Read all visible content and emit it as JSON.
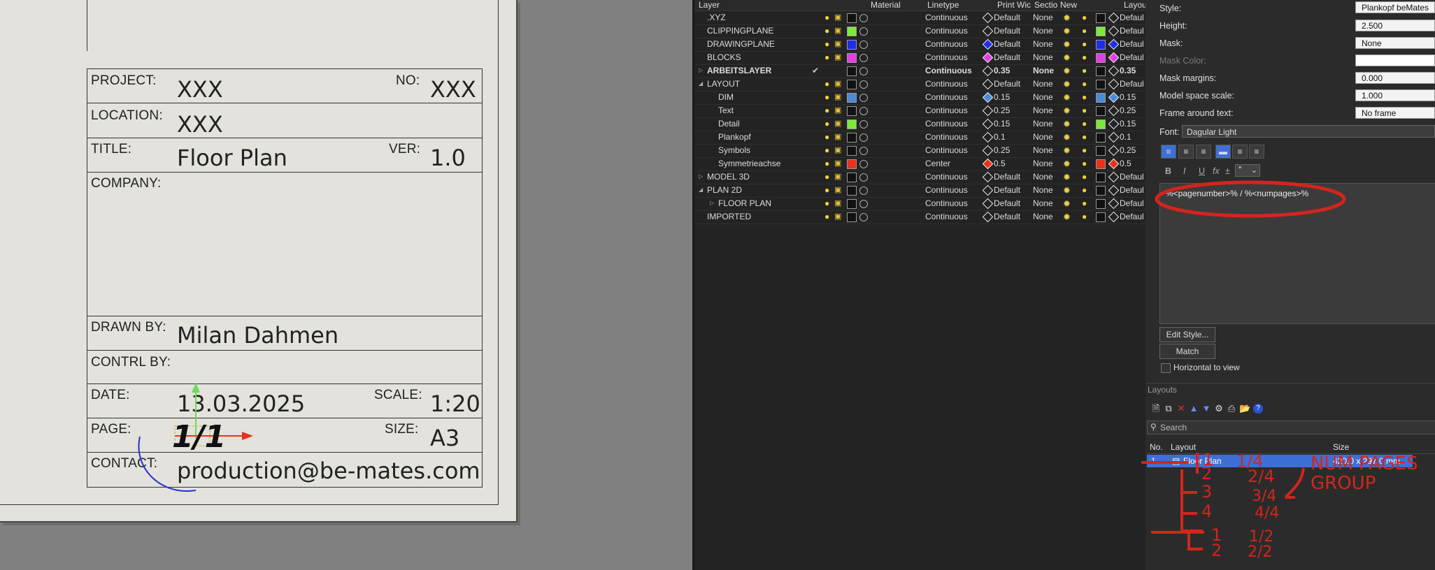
{
  "title_block": {
    "project_label": "PROJECT:",
    "project_value": "XXX",
    "no_label": "NO:",
    "no_value": "XXX",
    "location_label": "LOCATION:",
    "location_value": "XXX",
    "title_label": "TITLE:",
    "title_value": "Floor Plan",
    "ver_label": "VER:",
    "ver_value": "1.0",
    "company_label": "COMPANY:",
    "drawn_by_label": "DRAWN BY:",
    "drawn_by_value": "Milan Dahmen",
    "contrl_by_label": "CONTRL BY:",
    "date_label": "DATE:",
    "date_value": "13.03.2025",
    "scale_label": "SCALE:",
    "scale_value": "1:20",
    "page_label": "PAGE:",
    "page_value": "1/1",
    "size_label": "SIZE:",
    "size_value": "A3",
    "contact_label": "CONTACT:",
    "contact_value": "production@be-mates.com"
  },
  "layer_panel": {
    "headers": [
      "Layer",
      "Material",
      "Linetype",
      "Print Wic",
      "Sectio",
      "New",
      "Layou"
    ],
    "rows": [
      {
        "name": ".XYZ",
        "linetype": "Continuous",
        "print": "Default",
        "section": "None",
        "layout": "Defaul",
        "color": "#111111",
        "bold": false
      },
      {
        "name": "CLIPPINGPLANE",
        "linetype": "Continuous",
        "print": "Default",
        "section": "None",
        "layout": "Defaul",
        "color": "#7ee83a",
        "bold": false
      },
      {
        "name": "DRAWINGPLANE",
        "linetype": "Continuous",
        "print": "Default",
        "section": "None",
        "layout": "Defaul",
        "color": "#1f2ee8",
        "bold": false
      },
      {
        "name": "BLOCKS",
        "linetype": "Continuous",
        "print": "Default",
        "section": "None",
        "layout": "Defaul",
        "color": "#e040e0",
        "bold": false
      },
      {
        "name": "ARBEITSLAYER",
        "linetype": "Continuous",
        "print": "0.35",
        "section": "None",
        "layout": "0.35",
        "color": "#111111",
        "bold": true
      },
      {
        "name": "LAYOUT",
        "linetype": "Continuous",
        "print": "Default",
        "section": "None",
        "layout": "Defaul",
        "color": "#111111",
        "bold": false
      },
      {
        "name": "DIM",
        "linetype": "Continuous",
        "print": "0.15",
        "section": "None",
        "layout": "0.15",
        "color": "#4a8ad8",
        "bold": false
      },
      {
        "name": "Text",
        "linetype": "Continuous",
        "print": "0.25",
        "section": "None",
        "layout": "0.25",
        "color": "#111111",
        "bold": false
      },
      {
        "name": "Detail",
        "linetype": "Continuous",
        "print": "0.15",
        "section": "None",
        "layout": "0.15",
        "color": "#7ee83a",
        "bold": false
      },
      {
        "name": "Plankopf",
        "linetype": "Continuous",
        "print": "0.1",
        "section": "None",
        "layout": "0.1",
        "color": "#111111",
        "bold": false
      },
      {
        "name": "Symbols",
        "linetype": "Continuous",
        "print": "0.25",
        "section": "None",
        "layout": "0.25",
        "color": "#111111",
        "bold": false
      },
      {
        "name": "Symmetrieachse",
        "linetype": "Center",
        "print": "0.5",
        "section": "None",
        "layout": "0.5",
        "color": "#e8321c",
        "bold": false
      },
      {
        "name": "MODEL 3D",
        "linetype": "Continuous",
        "print": "Default",
        "section": "None",
        "layout": "Defaul",
        "color": "#111111",
        "bold": false
      },
      {
        "name": "PLAN 2D",
        "linetype": "Continuous",
        "print": "Default",
        "section": "None",
        "layout": "Defaul",
        "color": "#111111",
        "bold": false
      },
      {
        "name": "FLOOR PLAN",
        "linetype": "Continuous",
        "print": "Default",
        "section": "None",
        "layout": "Defaul",
        "color": "#111111",
        "bold": false
      },
      {
        "name": "IMPORTED",
        "linetype": "Continuous",
        "print": "Default",
        "section": "None",
        "layout": "Defaul",
        "color": "#111111",
        "bold": false
      }
    ]
  },
  "properties": {
    "style_label": "Style:",
    "style_value": "Plankopf beMates",
    "height_label": "Height:",
    "height_value": "2.500",
    "mask_label": "Mask:",
    "mask_value": "None",
    "mask_color_label": "Mask Color:",
    "mask_margins_label": "Mask margins:",
    "mask_margins_value": "0.000",
    "model_scale_label": "Model space scale:",
    "model_scale_value": "1.000",
    "frame_label": "Frame around text:",
    "frame_value": "No frame",
    "font_label": "Font:",
    "font_value": "Dagular Light",
    "format_buttons": [
      "B",
      "I",
      "U",
      "fx",
      "±"
    ],
    "format_dropdown": "*",
    "text_content": "%<pagenumber>% / %<numpages>%",
    "edit_style": "Edit Style...",
    "match": "Match",
    "horizontal": "Horizontal to view"
  },
  "layouts": {
    "section_title": "Layouts",
    "search_placeholder": "Search",
    "col_no": "No.",
    "col_layout": "Layout",
    "col_size": "Size",
    "selected_name": "Floor Plan",
    "selected_size": "420.0 x 297.0 mm",
    "selected_no": "1"
  },
  "annotations": {
    "a1": "1",
    "a1b": "1/4",
    "a2": "2",
    "a2b": "2/4",
    "a3": "3",
    "a3b": "3/4",
    "a4": "4",
    "a4b": "4/4",
    "note": "NUM PAGES\nGROUP",
    "b1": "1",
    "b1b": "1/2",
    "b2": "2",
    "b2b": "2/2"
  },
  "colors": {
    "accent_red": "#d3251c",
    "selection": "#3d6fd6",
    "gizmo_green": "#6cdc5a",
    "gizmo_red": "#e8321c",
    "gizmo_blue": "#2a32c8"
  }
}
